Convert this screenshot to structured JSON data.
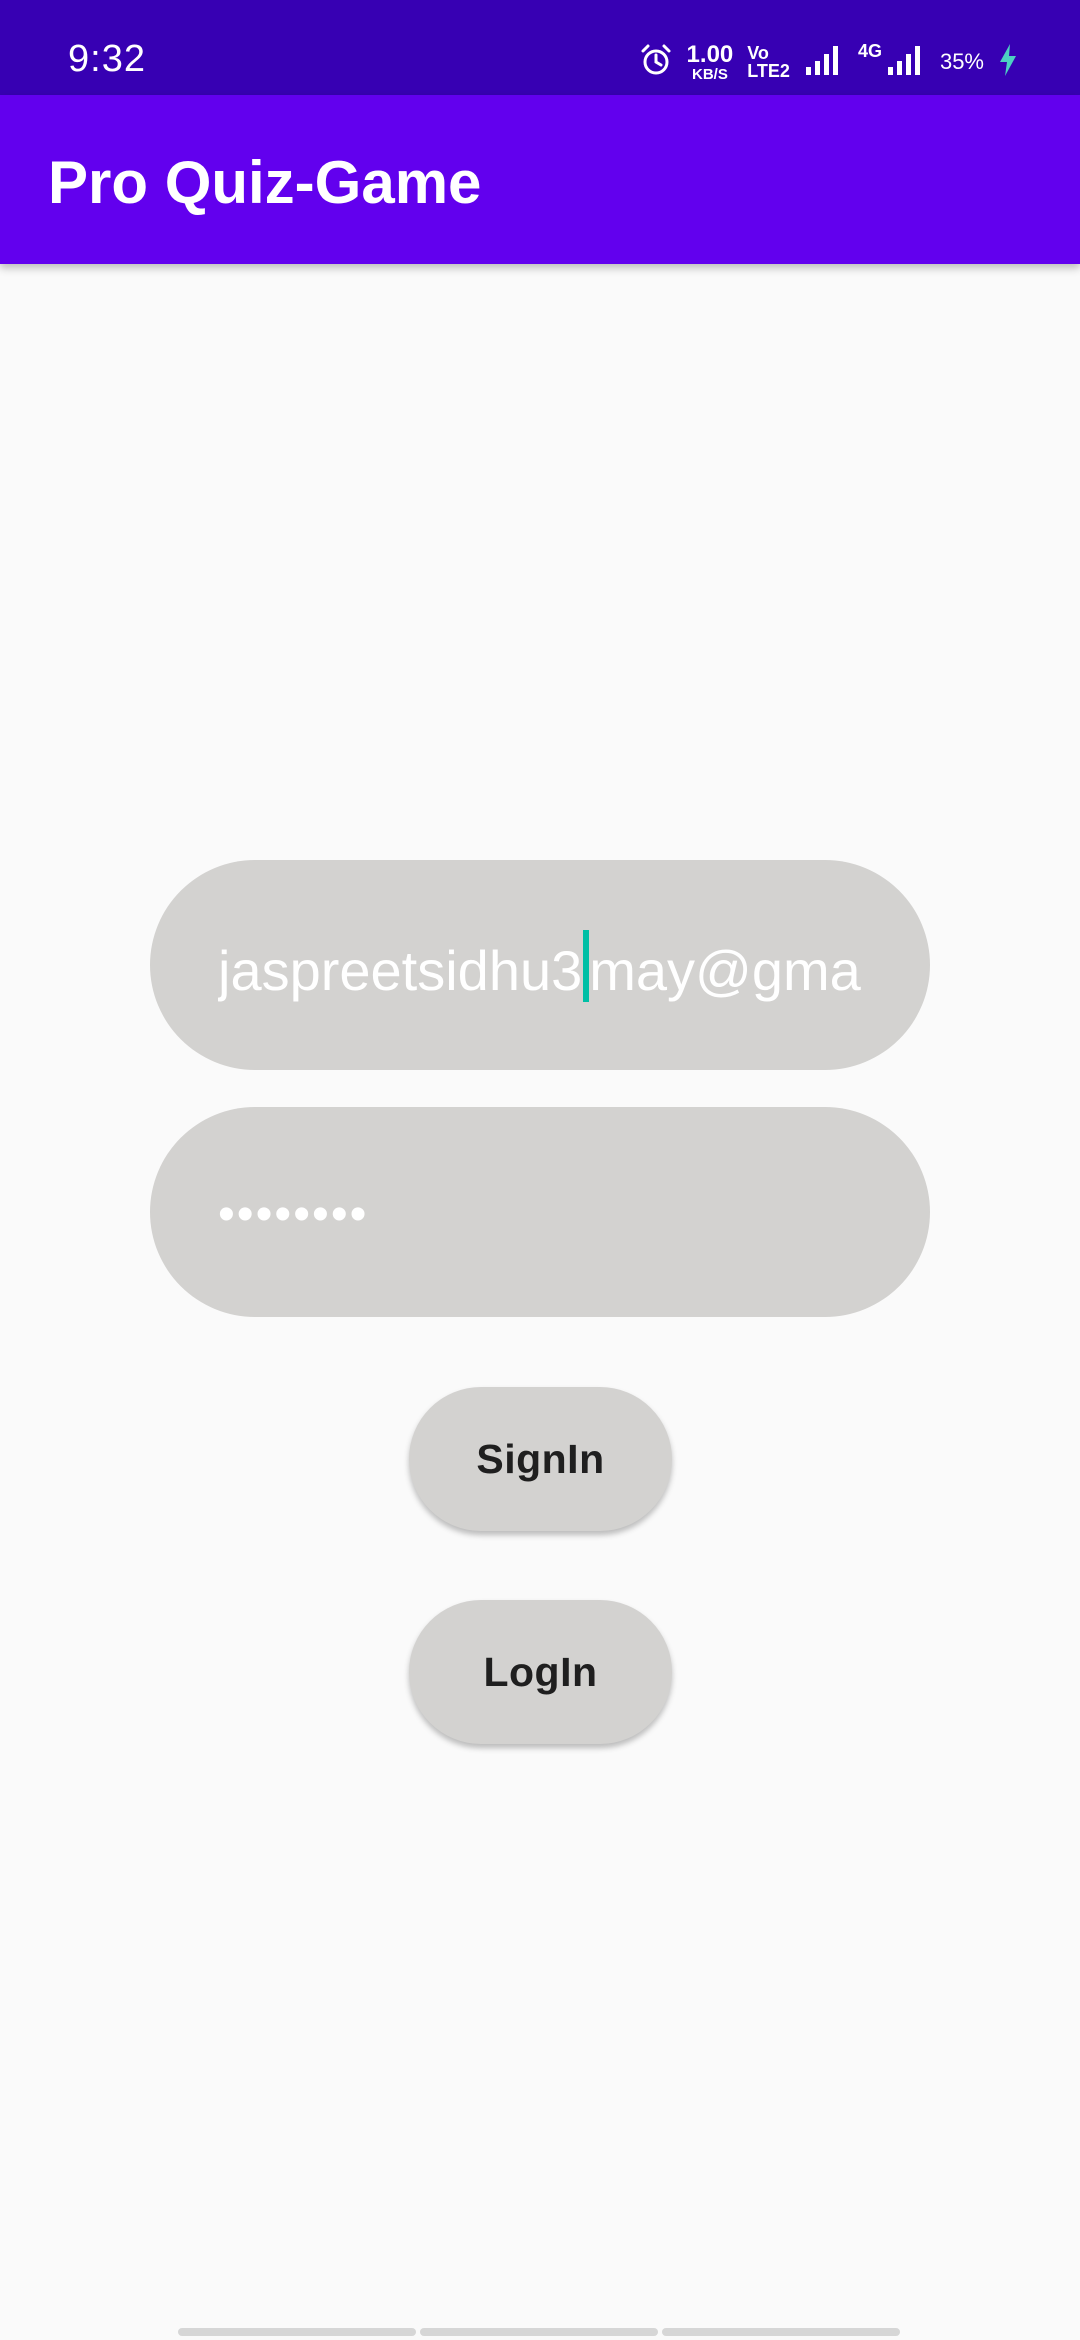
{
  "status_bar": {
    "time": "9:32",
    "net_speed_value": "1.00",
    "net_speed_unit": "KB/S",
    "volte_top": "Vo",
    "volte_bottom": "LTE2",
    "network_type": "4G",
    "battery": "35%",
    "icons": [
      "alarm-icon",
      "signal-icon",
      "signal-icon",
      "charging-icon"
    ]
  },
  "app_bar": {
    "title": "Pro Quiz-Game"
  },
  "email_field": {
    "value_before_cursor": "jaspreetsidhu3",
    "value_after_cursor": "may@gmail.",
    "cursor_color": "#00bfa5"
  },
  "password_field": {
    "value": "••••••••"
  },
  "buttons": {
    "signin_label": "SignIn",
    "login_label": "LogIn"
  },
  "colors": {
    "status_bar": "#3700b3",
    "app_bar": "#6200ee",
    "background": "#fafafa",
    "field_bg": "#d3d2d0"
  }
}
